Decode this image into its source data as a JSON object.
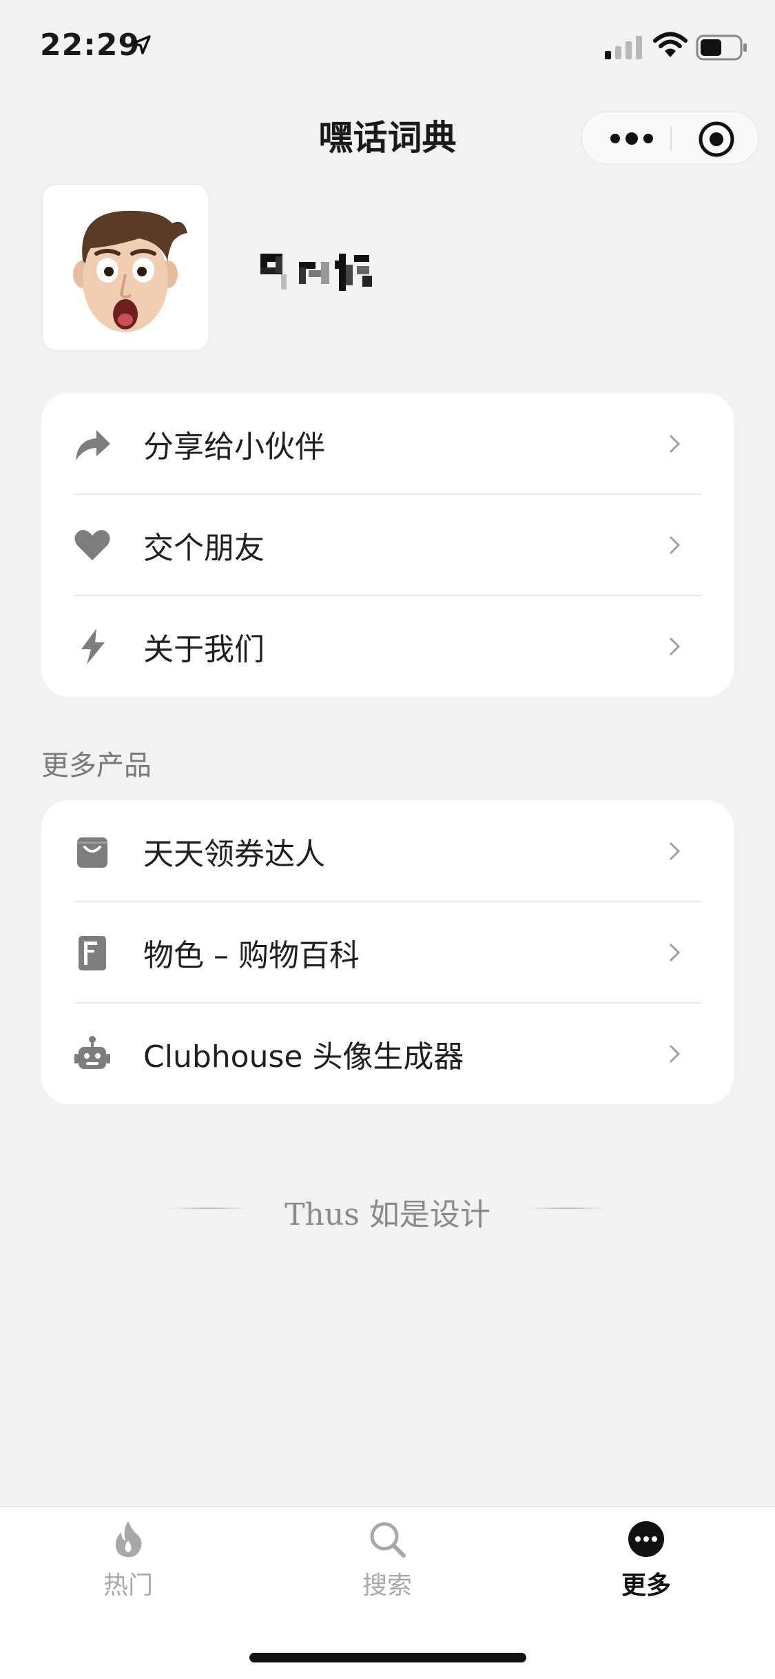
{
  "status_bar": {
    "time": "22:29"
  },
  "nav": {
    "title": "嘿话词典"
  },
  "profile": {
    "avatar_icon": "memoji-avatar",
    "nickname_obscured": true
  },
  "menu": {
    "items": [
      {
        "label": "分享给小伙伴",
        "icon": "share-arrow-icon"
      },
      {
        "label": "交个朋友",
        "icon": "heart-icon"
      },
      {
        "label": "关于我们",
        "icon": "lightning-icon"
      }
    ]
  },
  "more_products": {
    "title": "更多产品",
    "items": [
      {
        "label": "天天领券达人",
        "icon": "shopping-bag-icon"
      },
      {
        "label": "物色 – 购物百科",
        "icon": "notebook-icon"
      },
      {
        "label": "Clubhouse 头像生成器",
        "icon": "robot-icon"
      }
    ]
  },
  "footer": {
    "text": "Thus 如是设计"
  },
  "tabbar": {
    "tabs": [
      {
        "label": "热门",
        "icon": "flame-icon",
        "active": false
      },
      {
        "label": "搜索",
        "icon": "search-icon",
        "active": false
      },
      {
        "label": "更多",
        "icon": "more-circle-icon",
        "active": true
      }
    ]
  },
  "colors": {
    "background": "#f2f2f2",
    "card": "#ffffff",
    "icon_gray": "#7d7d7d",
    "active": "#111111"
  }
}
